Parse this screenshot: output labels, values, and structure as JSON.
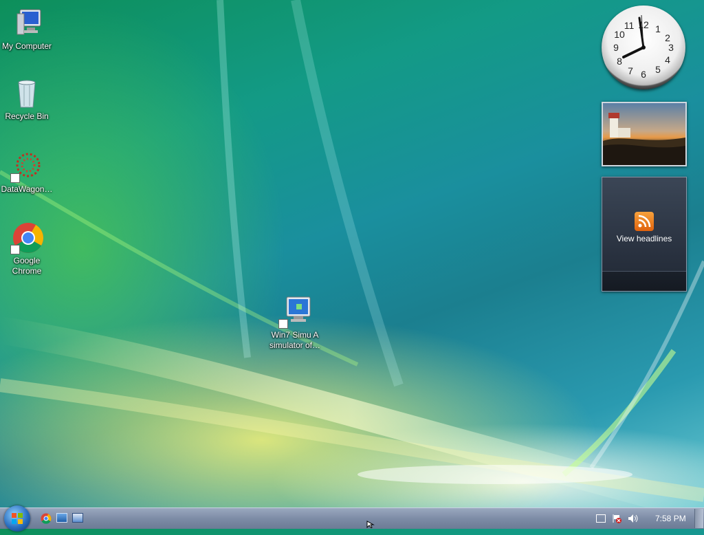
{
  "desktop": {
    "icons": [
      {
        "label": "My Computer"
      },
      {
        "label": "Recycle Bin"
      },
      {
        "label": "DataWagon…"
      },
      {
        "label": "Google Chrome"
      },
      {
        "label": "Win7 Simu   A simulator of…"
      }
    ]
  },
  "gadgets": {
    "clock": {
      "numbers": [
        "12",
        "1",
        "2",
        "3",
        "4",
        "5",
        "6",
        "7",
        "8",
        "9",
        "10",
        "11"
      ]
    },
    "feed": {
      "label": "View headlines"
    }
  },
  "taskbar": {
    "clock": "7:58 PM"
  }
}
